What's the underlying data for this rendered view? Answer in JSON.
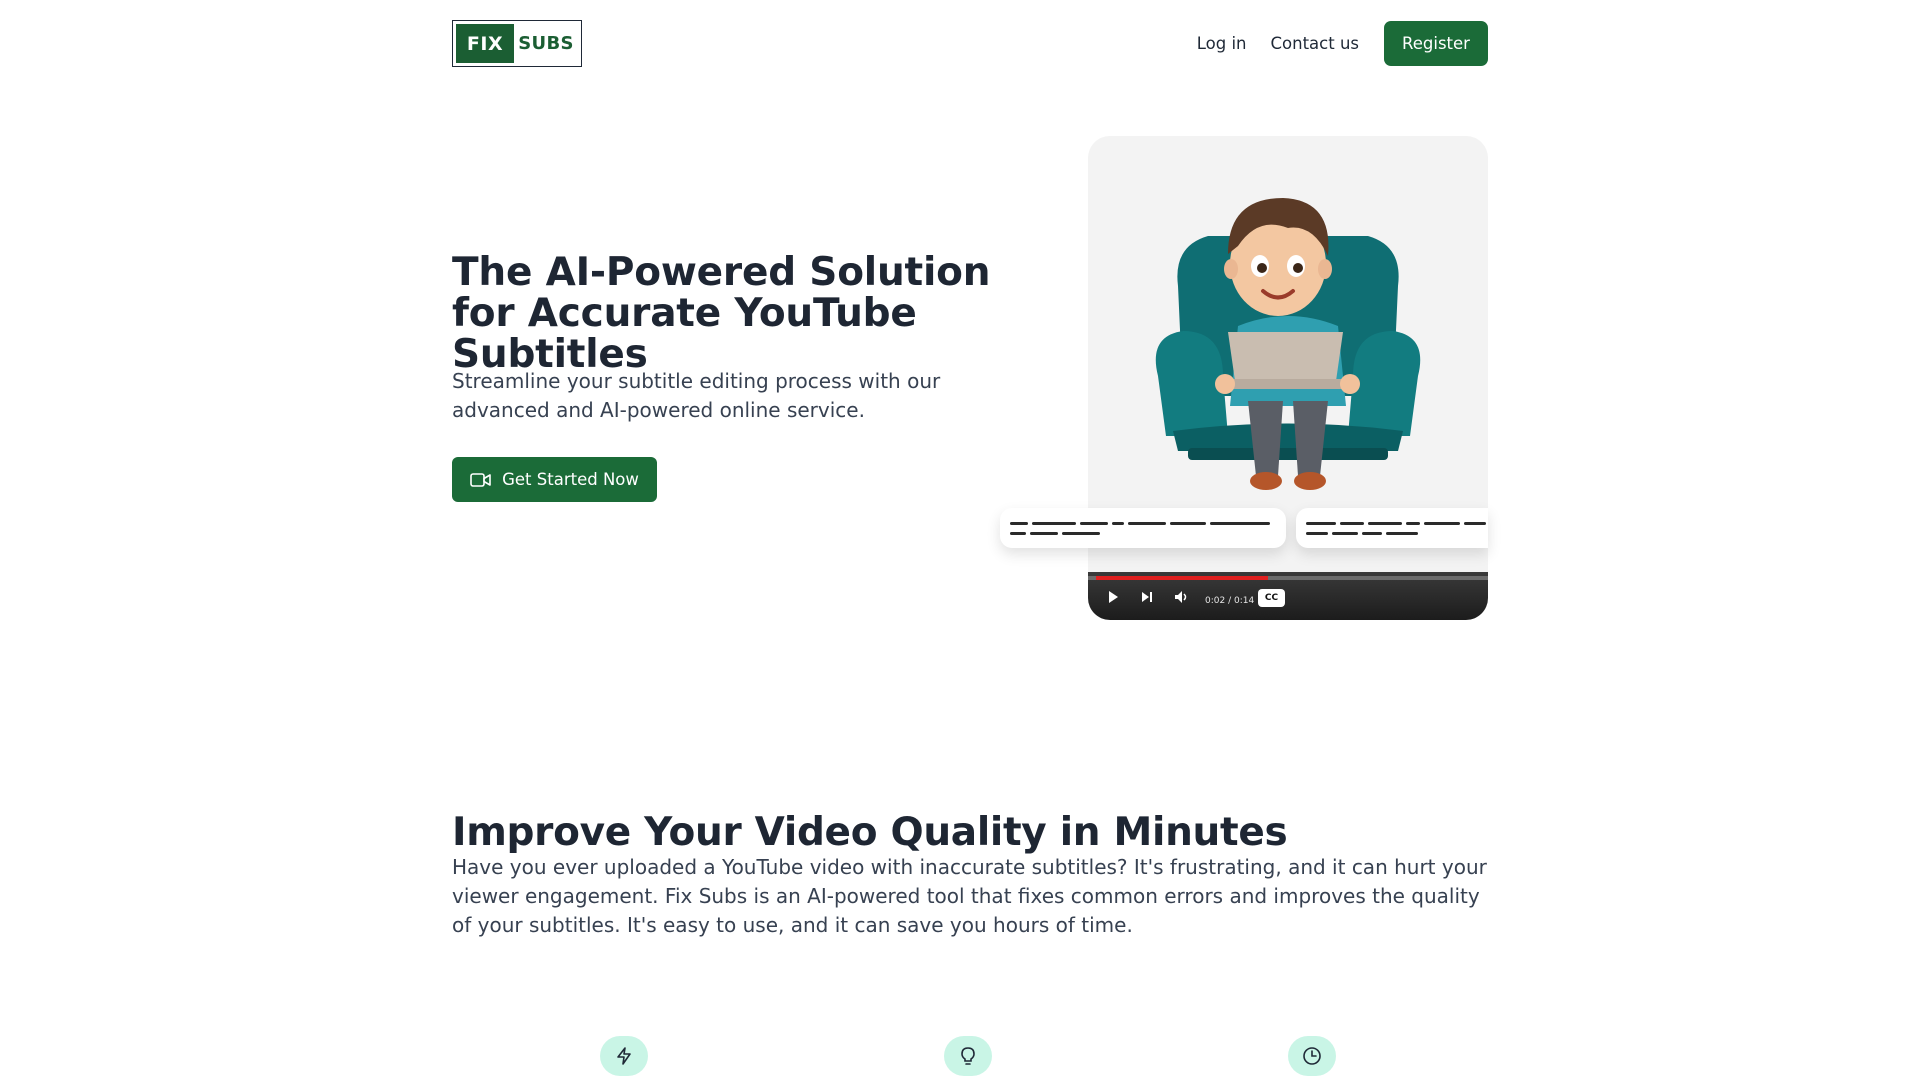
{
  "header": {
    "logo": {
      "part1": "FIX",
      "part2": "SUBS"
    },
    "nav": {
      "login": "Log in",
      "contact": "Contact us",
      "register": "Register"
    }
  },
  "hero": {
    "title": "The AI-Powered Solution for Accurate YouTube Subtitles",
    "subtitle": "Streamline your subtitle editing process with our advanced and AI-powered online service.",
    "cta": "Get Started Now",
    "cta_icon": "video-camera-icon"
  },
  "player": {
    "timecode": "0:02 / 0:14",
    "cc_label": "CC",
    "progress": 0.43,
    "icons": [
      "play-icon",
      "skip-next-icon",
      "volume-icon"
    ]
  },
  "section": {
    "title": "Improve Your Video Quality in Minutes",
    "body": "Have you ever uploaded a YouTube video with inaccurate subtitles? It's frustrating, and it can hurt your viewer engagement. Fix Subs is an AI-powered tool that fixes common errors and improves the quality of your subtitles. It's easy to use, and it can save you hours of time."
  },
  "features": {
    "icons": [
      "lightning-icon",
      "lightbulb-icon",
      "clock-icon"
    ]
  },
  "colors": {
    "brand": "#1b6b38",
    "text": "#1e2633",
    "feature_bg": "#c9f5e6"
  }
}
